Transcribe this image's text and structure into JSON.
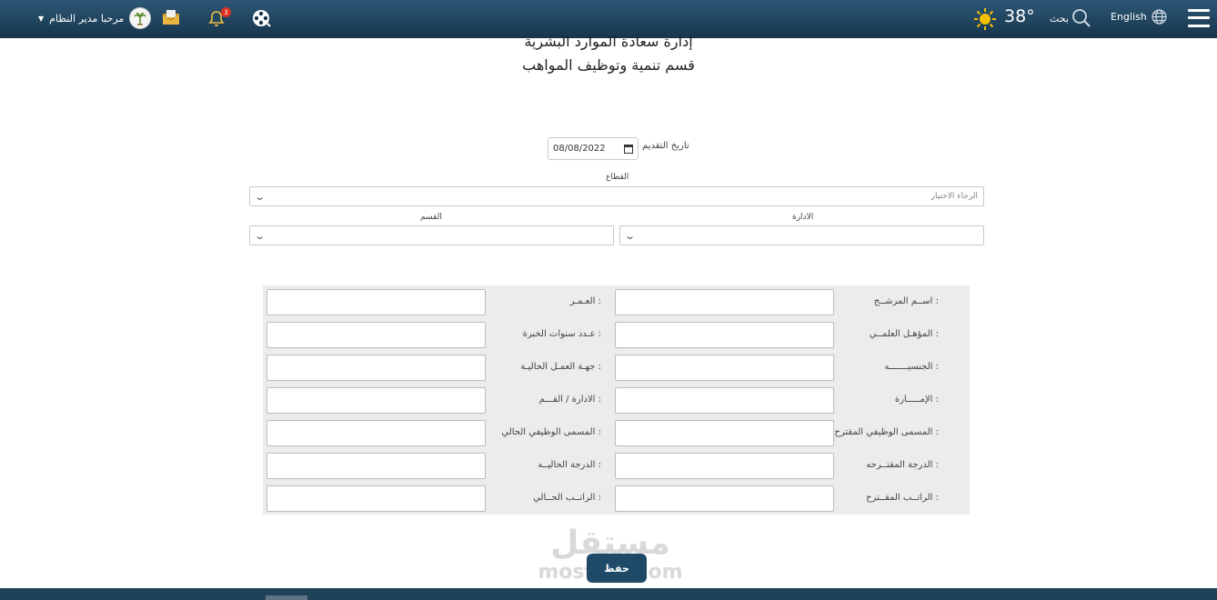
{
  "topbar": {
    "welcome": "مرحبا مدير النظام",
    "notification_count": "3",
    "temperature": "38°",
    "search_label": "بحث",
    "language_label": "English"
  },
  "header": {
    "line1": "إدارة سعادة الموارد البشرية",
    "line2": "قسم تنمية وتوظيف المواهب"
  },
  "application_date": {
    "label": "تاريخ التقديم",
    "value": "08/08/2022"
  },
  "sector": {
    "label": "القطاع",
    "placeholder": "الرجاء الاختيار"
  },
  "administration": {
    "label": "الادارة"
  },
  "section": {
    "label": "القسم"
  },
  "form": {
    "right_labels": [
      "اســم المرشــح :",
      "المؤهـل العلمــي :",
      "الجنسيـــــــه :",
      "الإمـــــارة :",
      "المسمى الوظيفي المقترح :",
      "الدرجة المقتــرحه :",
      "الراتــب المقــترح :"
    ],
    "left_labels": [
      "العـمـر :",
      "عـدد سنوات الخبرة :",
      "جهـة العمـل الحاليـة :",
      "الادارة / القـــم :",
      "المسمى الوظيفي الحالي :",
      "الدرجة الحاليــه :",
      "الراتــب الحــالي :"
    ]
  },
  "save_label": "حفظ",
  "watermark": {
    "arabic": "مستقل",
    "latin": "mostaql.com"
  },
  "colors": {
    "topbar": "#1f4560",
    "button": "#1e4a68",
    "panel": "#ececec"
  }
}
